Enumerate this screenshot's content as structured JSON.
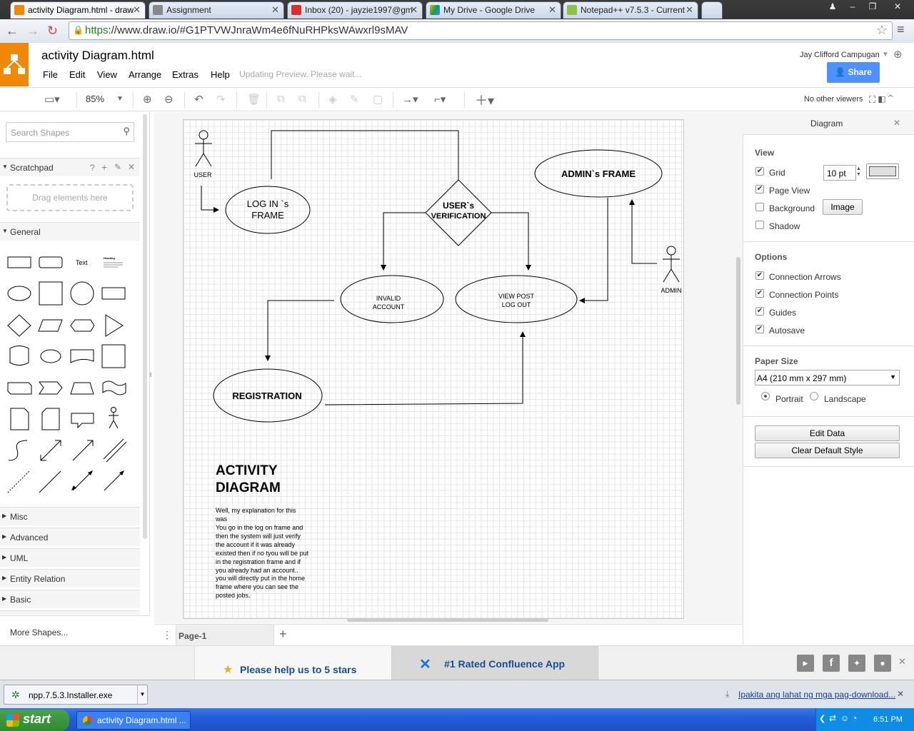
{
  "browser": {
    "tabs": [
      {
        "title": "activity Diagram.html - draw",
        "active": true
      },
      {
        "title": "Assignment",
        "active": false
      },
      {
        "title": "Inbox (20) - jayzie1997@gm",
        "active": false
      },
      {
        "title": "My Drive - Google Drive",
        "active": false
      },
      {
        "title": "Notepad++ v7.5.3 - Current",
        "active": false
      }
    ],
    "url_scheme": "https",
    "url_rest": "://www.draw.io/#G1PTVWJnraWm4e6fNuRHPksWAwxrl9sMAV"
  },
  "app": {
    "doc_title": "activity Diagram.html",
    "menu": [
      "File",
      "Edit",
      "View",
      "Arrange",
      "Extras",
      "Help"
    ],
    "status": "Updating Preview. Please wait...",
    "user": "Jay Clifford Campugan",
    "share_label": "Share",
    "zoom": "85%",
    "viewers": "No other viewers"
  },
  "left_panel": {
    "search_placeholder": "Search Shapes",
    "scratchpad": "Scratchpad",
    "scratchpad_help": "?",
    "drag_hint": "Drag elements here",
    "general": "General",
    "shape_text_label": "Text",
    "shape_heading_label": "Heading",
    "sections": [
      "Misc",
      "Advanced",
      "UML",
      "Entity Relation",
      "Basic"
    ],
    "more_shapes": "More Shapes..."
  },
  "diagram": {
    "user_label": "USER",
    "admin_label": "ADMIN",
    "login_line1": "LOG IN `s",
    "login_line2": "FRAME",
    "verify_line1": "USER`s",
    "verify_line2": "VERIFICATION",
    "admin_frame": "ADMIN`s FRAME",
    "invalid_line1": "INVALID",
    "invalid_line2": "ACCOUNT",
    "view_line1": "VIEW POST",
    "view_line2": "LOG OUT",
    "registration": "REGISTRATION",
    "heading_line1": "ACTIVITY",
    "heading_line2": "DIAGRAM",
    "explanation": [
      "Well, my explanation for this",
      "was",
      "You go in the log on frame and",
      "then the system will just verify",
      "the account if it was  already",
      "existed then if no tyou will be put",
      "in the registration frame and if",
      "you already had an account..",
      "you will directly put in the home",
      "frame where you can see the",
      "posted jobs."
    ]
  },
  "right_panel": {
    "title": "Diagram",
    "view_title": "View",
    "grid": "Grid",
    "grid_size": "10 pt",
    "page_view": "Page View",
    "background": "Background",
    "image_btn": "Image",
    "shadow": "Shadow",
    "options_title": "Options",
    "connection_arrows": "Connection Arrows",
    "connection_points": "Connection Points",
    "guides": "Guides",
    "autosave": "Autosave",
    "paper_size_title": "Paper Size",
    "paper_size": "A4 (210 mm x 297 mm)",
    "portrait": "Portrait",
    "landscape": "Landscape",
    "edit_data": "Edit Data",
    "clear_style": "Clear Default Style",
    "checks": {
      "grid": true,
      "page_view": true,
      "background": false,
      "shadow": false,
      "connection_arrows": true,
      "connection_points": true,
      "guides": true,
      "autosave": true
    }
  },
  "bottom": {
    "page_tab": "Page-1",
    "rate_text": "Please help us to 5 stars",
    "confluence_text": "#1 Rated Confluence App",
    "download_file": "npp.7.5.3.Installer.exe",
    "download_all": "Ipakita ang lahat ng mga pag-download...",
    "start": "start",
    "task_item": "activity Diagram.html ...",
    "clock": "6:51 PM"
  }
}
